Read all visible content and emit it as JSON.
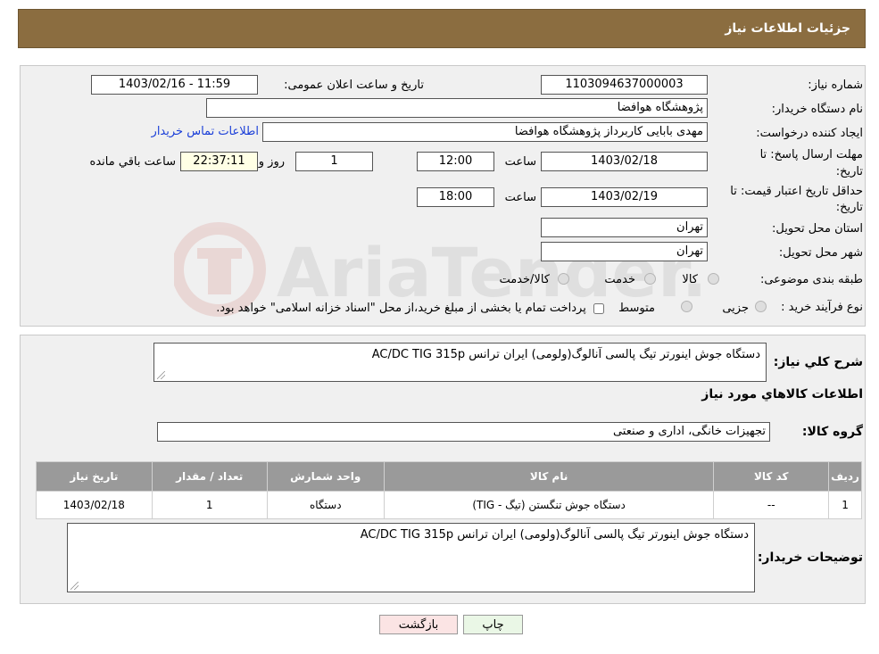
{
  "header": {
    "title": "جزئیات اطلاعات نیاز"
  },
  "form": {
    "need_number_label": "شماره نیاز:",
    "need_number": "1103094637000003",
    "announce_label": "تاریخ و ساعت اعلان عمومی:",
    "announce_value": "1403/02/16 - 11:59",
    "buyer_org_label": "نام دستگاه خریدار:",
    "buyer_org": "پژوهشگاه هوافضا",
    "creator_label": "ایجاد کننده درخواست:",
    "creator": "مهدی بابایی کاربرداز پژوهشگاه هوافضا",
    "contact_link": "اطلاعات تماس خریدار",
    "deadline_label_1": "مهلت ارسال پاسخ: تا",
    "deadline_label_2": "تاریخ:",
    "deadline_date": "1403/02/18",
    "time_label": "ساعت",
    "deadline_time": "12:00",
    "days_value": "1",
    "days_label": "روز و",
    "remaining_value": "22:37:11",
    "remaining_label": "ساعت باقي مانده",
    "validity_label_1": "حداقل تاریخ اعتبار قیمت: تا",
    "validity_label_2": "تاریخ:",
    "validity_date": "1403/02/19",
    "validity_time": "18:00",
    "province_label": "استان محل تحویل:",
    "province": "تهران",
    "city_label": "شهر محل تحویل:",
    "city": "تهران",
    "category_label": "طبقه بندی موضوعی:",
    "category_options": [
      "کالا",
      "خدمت",
      "کالا/خدمت"
    ],
    "process_label": "نوع فرآیند خرید :",
    "process_options": [
      "جزیی",
      "متوسط"
    ],
    "process_note": "پرداخت تمام یا بخشی از مبلغ خرید،از محل \"اسناد خزانه اسلامی\" خواهد بود."
  },
  "details": {
    "summary_label": "شرح کلي نياز:",
    "summary_text": "دستگاه جوش اینورتر تیگ پالسی آنالوگ(ولومی) ایران ترانس AC/DC     TIG 315p",
    "items_title": "اطلاعات کالاهاي مورد نياز",
    "group_label": "گروه کالا:",
    "group_value": "تجهیزات خانگی، اداری و صنعتی",
    "table": {
      "headers": [
        "ردیف",
        "کد کالا",
        "نام کالا",
        "واحد شمارش",
        "تعداد / مقدار",
        "تاریخ نیاز"
      ],
      "rows": [
        [
          "1",
          "--",
          "دستگاه جوش تنگستن (تیگ - TIG)",
          "دستگاه",
          "1",
          "1403/02/18"
        ]
      ]
    },
    "buyer_notes_label": "توضیحات خریدار:",
    "buyer_notes_text": "دستگاه جوش اینورتر تیگ پالسی آنالوگ(ولومی) ایران ترانس AC/DC     TIG 315p"
  },
  "buttons": {
    "print": "چاپ",
    "back": "بازگشت"
  },
  "watermark": "AriaTender.neT",
  "colors": {
    "header_bg": "#8b6d40",
    "panel_bg": "#f0f0f0",
    "table_header": "#9a9a9a",
    "back_btn": "#fbe4e4",
    "print_btn": "#eaf7e6"
  }
}
